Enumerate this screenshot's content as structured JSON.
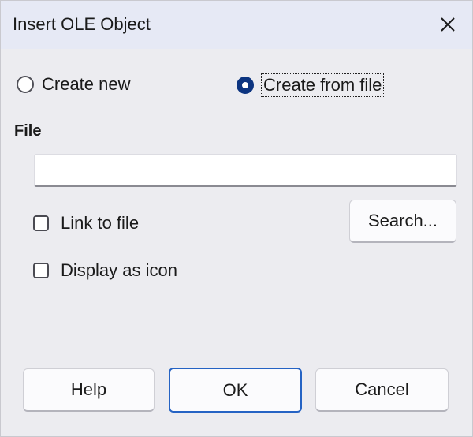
{
  "window": {
    "title": "Insert OLE Object",
    "close_icon": "close-icon"
  },
  "mode": {
    "selected": "create-from-file",
    "options": {
      "create_new": "Create new",
      "create_from_file": "Create from file"
    }
  },
  "file": {
    "label": "File",
    "value": "",
    "placeholder": ""
  },
  "options": {
    "link_to_file": {
      "label": "Link to file",
      "checked": false
    },
    "display_as_icon": {
      "label": "Display as icon",
      "checked": false
    }
  },
  "buttons": {
    "search": "Search...",
    "help": "Help",
    "ok": "OK",
    "cancel": "Cancel"
  },
  "colors": {
    "accent": "#0c3480",
    "default_button_border": "#2563c4",
    "titlebar": "#e6e9f5",
    "body": "#ececf0"
  }
}
